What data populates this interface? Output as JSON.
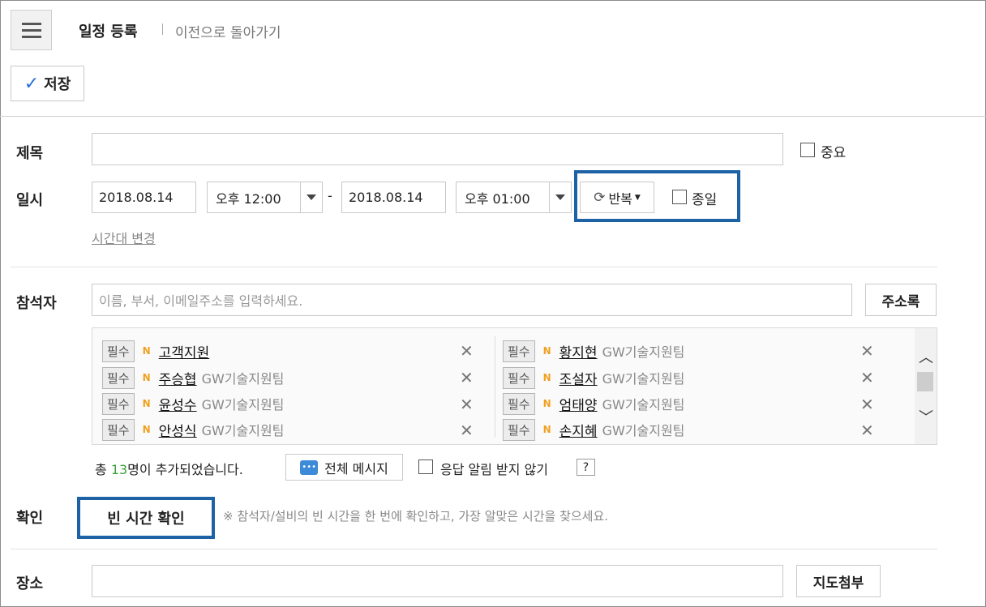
{
  "header": {
    "title": "일정 등록",
    "back_link": "이전으로 돌아가기",
    "save_label": "저장"
  },
  "form": {
    "subject_label": "제목",
    "important_label": "중요",
    "datetime_label": "일시",
    "start_date": "2018.08.14",
    "start_time": "오후 12:00",
    "dash": "-",
    "end_date": "2018.08.14",
    "end_time": "오후 01:00",
    "repeat_label": "반복",
    "allday_label": "종일",
    "timezone_link": "시간대 변경",
    "attendee_label": "참석자",
    "attendee_placeholder": "이름, 부서, 이메일주소를 입력하세요.",
    "addressbook_label": "주소록",
    "confirm_label": "확인",
    "free_time_button": "빈 시간 확인",
    "free_time_hint": "※ 참석자/설비의 빈 시간을 한 번에 확인하고, 가장 알맞은 시간을 찾으세요.",
    "place_label": "장소",
    "map_button": "지도첨부"
  },
  "participants": {
    "badge": "필수",
    "left": [
      {
        "name": "고객지원",
        "team": ""
      },
      {
        "name": "주승협",
        "team": "GW기술지원팀"
      },
      {
        "name": "윤성수",
        "team": "GW기술지원팀"
      },
      {
        "name": "안성식",
        "team": "GW기술지원팀"
      }
    ],
    "right": [
      {
        "name": "황지현",
        "team": "GW기술지원팀"
      },
      {
        "name": "조설자",
        "team": "GW기술지원팀"
      },
      {
        "name": "엄태양",
        "team": "GW기술지원팀"
      },
      {
        "name": "손지혜",
        "team": "GW기술지원팀"
      }
    ]
  },
  "summary": {
    "prefix": "총 ",
    "count": "13",
    "suffix": "명이 추가되었습니다.",
    "message_all": "전체 메시지",
    "no_alert": "응답 알림 받지 않기",
    "help": "?"
  },
  "icons": {
    "menu": "hamburger-icon",
    "check": "checkmark-icon",
    "repeat": "refresh-icon",
    "remove": "close-icon",
    "scroll_up": "chevron-up-icon",
    "scroll_down": "chevron-down-icon",
    "message": "chat-bubble-icon"
  },
  "colors": {
    "accent_blue": "#1c62a5",
    "check_blue": "#2a6ed8",
    "count_green": "#3aa03a",
    "n_badge": "#f0a020"
  }
}
